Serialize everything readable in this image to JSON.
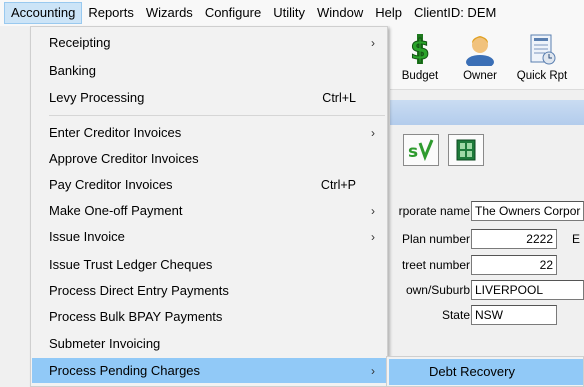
{
  "menubar": {
    "items": [
      "Accounting",
      "Reports",
      "Wizards",
      "Configure",
      "Utility",
      "Window",
      "Help"
    ],
    "client_id": "ClientID: DEM"
  },
  "toolbar": {
    "buttons": [
      {
        "label": "Budget",
        "icon": "dollar-icon"
      },
      {
        "label": "Owner",
        "icon": "person-icon"
      },
      {
        "label": "Quick Rpt",
        "icon": "report-icon"
      }
    ]
  },
  "form": {
    "corporate_name_label": "rporate name",
    "corporate_name_value": "The Owners Corpor",
    "plan_number_label": "Plan number",
    "plan_number_value": "2222",
    "street_number_label": "treet number",
    "street_number_value": "22",
    "town_label": "own/Suburb",
    "town_value": "LIVERPOOL",
    "state_label": "State",
    "state_value": "NSW",
    "extra_letter": "E"
  },
  "menu": {
    "items": [
      {
        "label": "Receipting",
        "shortcut": "",
        "submenu": true
      },
      {
        "label": "Banking",
        "shortcut": "",
        "submenu": false
      },
      {
        "label": "Levy Processing",
        "shortcut": "Ctrl+L",
        "submenu": false
      },
      {
        "label": "Enter Creditor Invoices",
        "shortcut": "",
        "submenu": true
      },
      {
        "label": "Approve Creditor Invoices",
        "shortcut": "",
        "submenu": false
      },
      {
        "label": "Pay Creditor Invoices",
        "shortcut": "Ctrl+P",
        "submenu": false
      },
      {
        "label": "Make One-off Payment",
        "shortcut": "",
        "submenu": true
      },
      {
        "label": "Issue Invoice",
        "shortcut": "",
        "submenu": true
      },
      {
        "label": "Issue Trust Ledger Cheques",
        "shortcut": "",
        "submenu": false
      },
      {
        "label": "Process Direct Entry Payments",
        "shortcut": "",
        "submenu": false
      },
      {
        "label": "Process Bulk BPAY Payments",
        "shortcut": "",
        "submenu": false
      },
      {
        "label": "Submeter Invoicing",
        "shortcut": "",
        "submenu": false
      },
      {
        "label": "Process Pending Charges",
        "shortcut": "",
        "submenu": true
      }
    ],
    "arrow": "›"
  },
  "submenu": {
    "item": "Debt Recovery"
  },
  "colors": {
    "highlight": "#91c9f7",
    "menubar_active": "#cce4f7",
    "sv_green": "#2e9b2e"
  }
}
